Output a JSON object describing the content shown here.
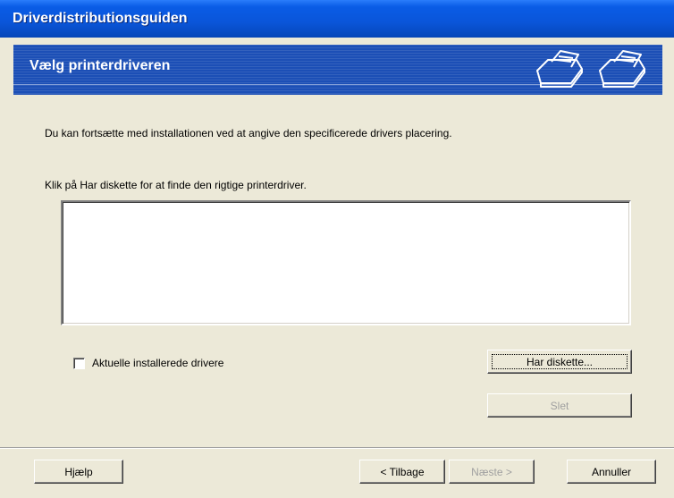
{
  "window": {
    "title": "Driverdistributionsguiden"
  },
  "header": {
    "heading": "Vælg printerdriveren",
    "icons": [
      "printer-icon",
      "printer-icon"
    ]
  },
  "content": {
    "intro": "Du kan fortsætte med installationen ved at angive den specificerede drivers placering.",
    "prompt": "Klik på Har diskette for at finde den rigtige printerdriver.",
    "driver_list": [],
    "checkbox": {
      "label": "Aktuelle installerede drivere",
      "checked": false
    },
    "buttons": {
      "have_disk": "Har diskette...",
      "delete": "Slet"
    }
  },
  "footer": {
    "help": "Hjælp",
    "back": "< Tilbage",
    "next": "Næste >",
    "cancel": "Annuller"
  },
  "colors": {
    "titlebar": "#0a55d9",
    "banner": "#1c4fb6",
    "window_bg": "#ece9d8",
    "disabled_text": "#a0a0a0"
  }
}
